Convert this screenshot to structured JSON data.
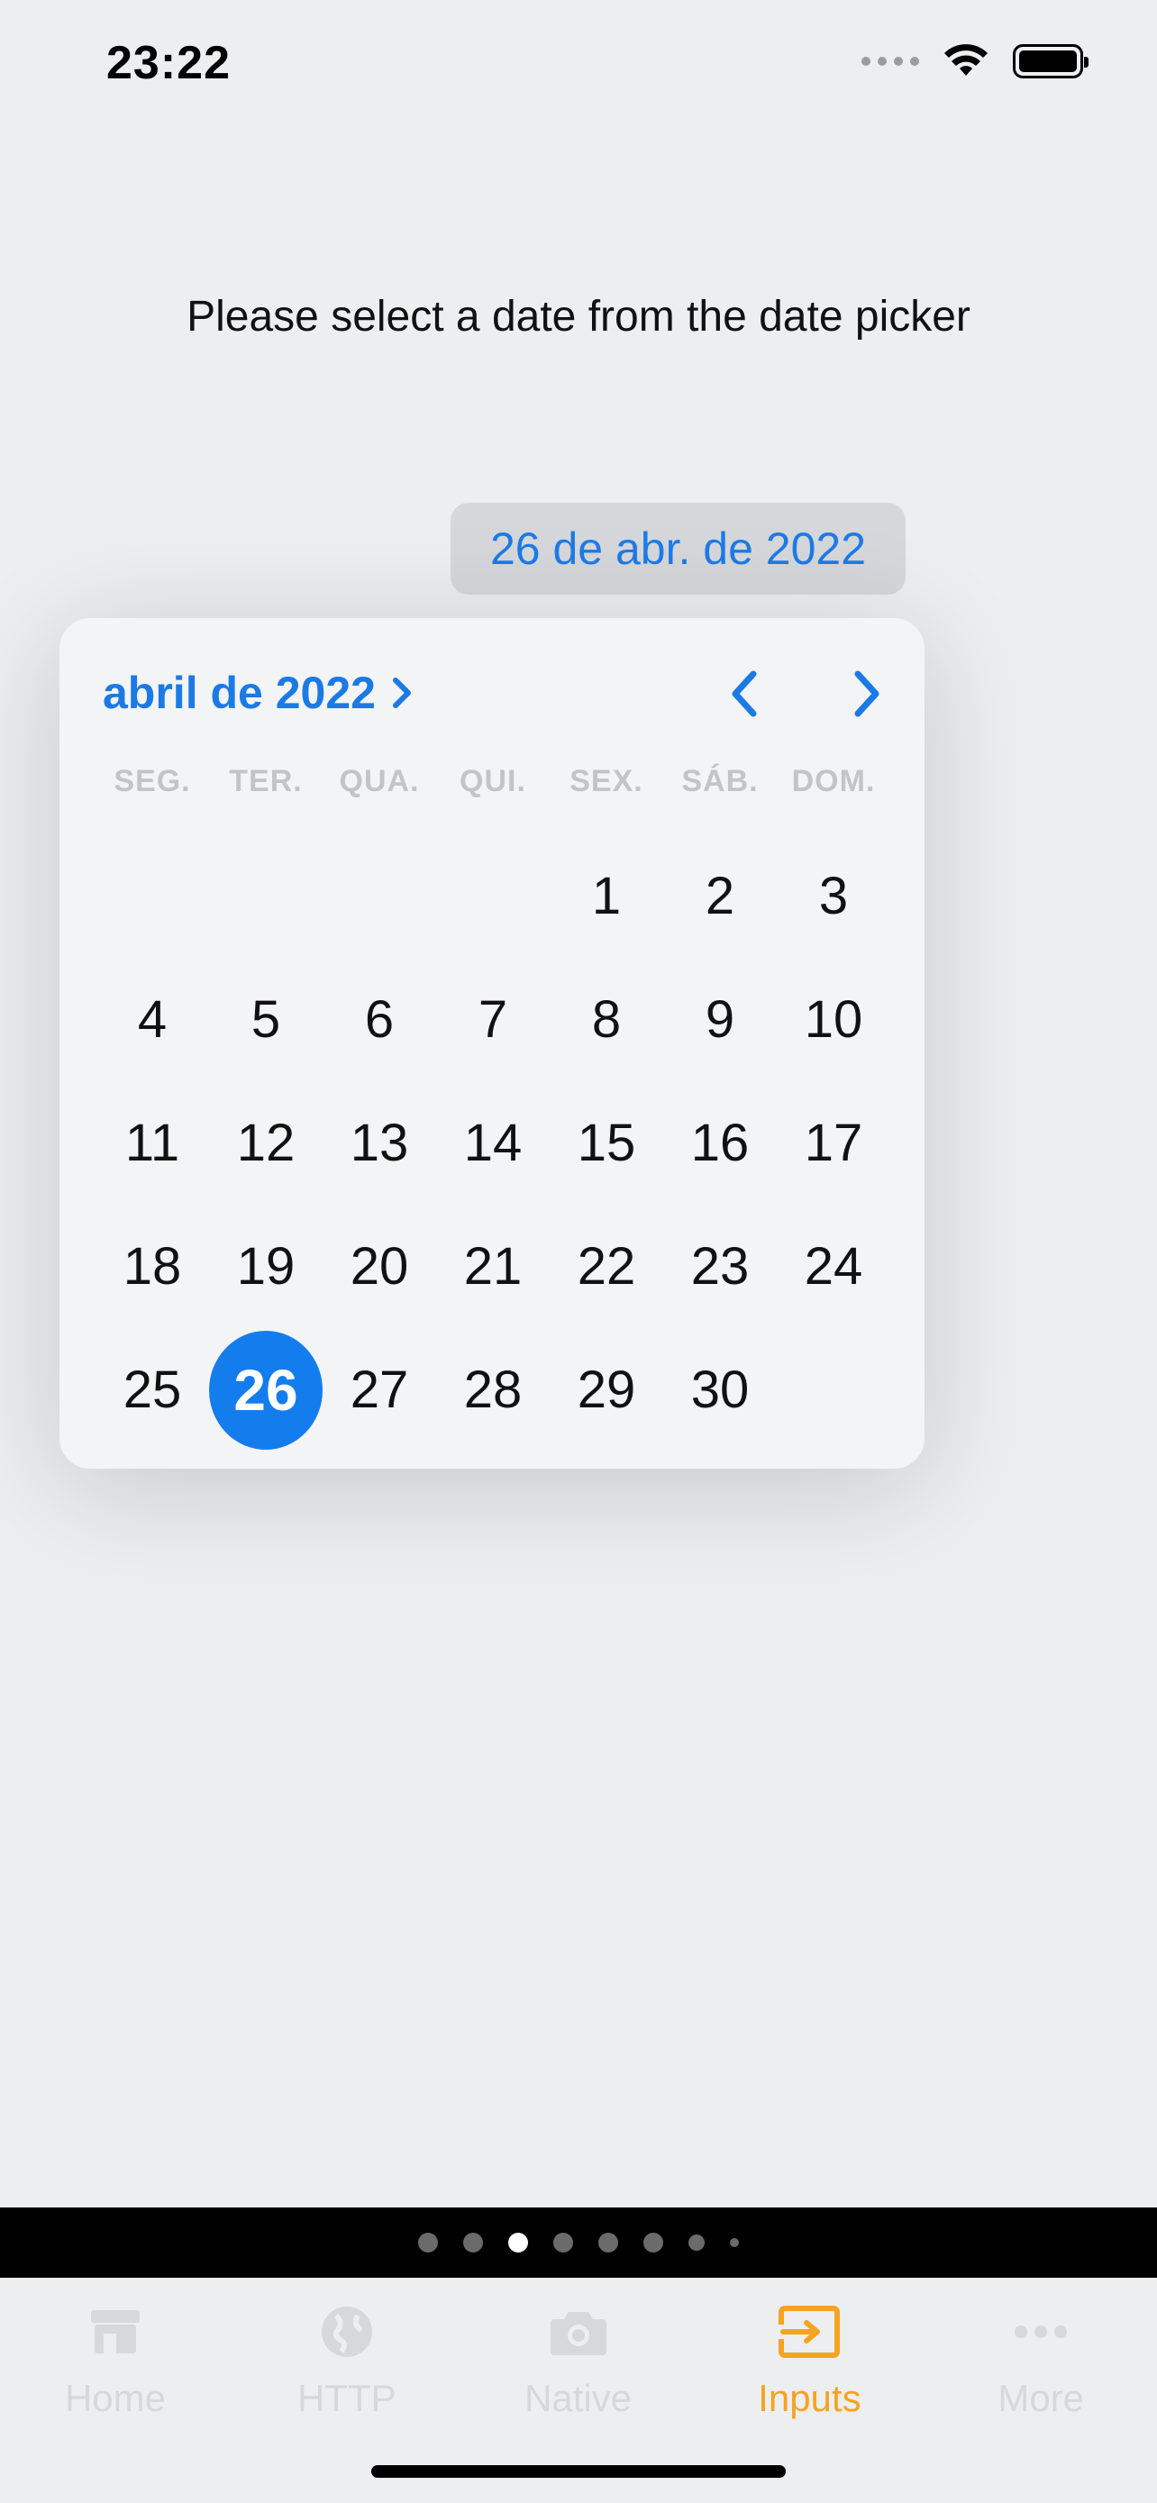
{
  "status_bar": {
    "time": "23:22",
    "icons": [
      "signal-icon",
      "wifi-icon",
      "battery-icon"
    ]
  },
  "instruction": "Please select a date from the date picker",
  "date_button": {
    "label": "26 de abr. de 2022"
  },
  "calendar": {
    "month_label": "abril de 2022",
    "weekdays": [
      "SEG.",
      "TER.",
      "QUA.",
      "QUI.",
      "SEX.",
      "SÁB.",
      "DOM."
    ],
    "leading_blanks": 4,
    "days": [
      "1",
      "2",
      "3",
      "4",
      "5",
      "6",
      "7",
      "8",
      "9",
      "10",
      "11",
      "12",
      "13",
      "14",
      "15",
      "16",
      "17",
      "18",
      "19",
      "20",
      "21",
      "22",
      "23",
      "24",
      "25",
      "26",
      "27",
      "28",
      "29",
      "30"
    ],
    "selected_day": "26"
  },
  "page_indicator": {
    "count": 8,
    "active_index": 2
  },
  "tabs": [
    {
      "label": "Home",
      "icon": "store-icon"
    },
    {
      "label": "HTTP",
      "icon": "globe-icon"
    },
    {
      "label": "Native",
      "icon": "camera-icon"
    },
    {
      "label": "Inputs",
      "icon": "input-icon"
    },
    {
      "label": "More",
      "icon": "more-icon"
    }
  ],
  "active_tab": 3,
  "colors": {
    "accent_blue": "#147dee",
    "tab_active": "#f5a322",
    "tab_inactive": "#d6d8db"
  }
}
